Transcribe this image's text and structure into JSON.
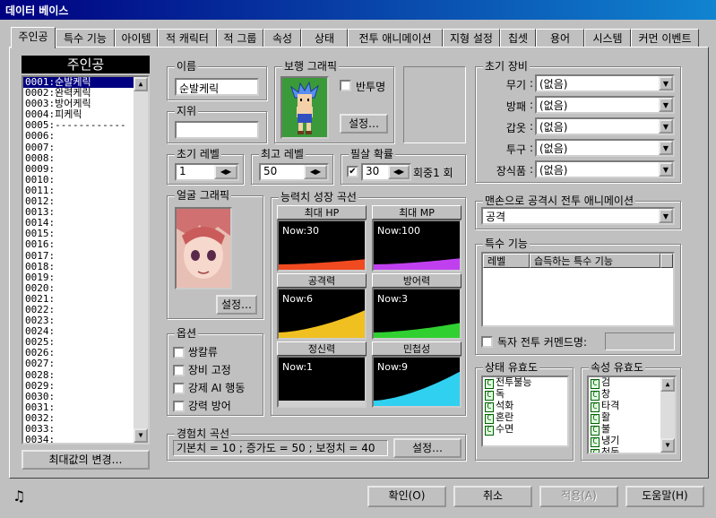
{
  "window": {
    "title": "데이터 베이스"
  },
  "tabs": [
    "주인공",
    "특수 기능",
    "아이템",
    "적 캐릭터",
    "적 그룹",
    "속성",
    "상태",
    "전투 애니메이션",
    "지형 설정",
    "칩셋",
    "용어",
    "시스템",
    "커먼 이벤트"
  ],
  "hero_list": {
    "title": "주인공",
    "items": [
      "0001:순발케릭",
      "0002:완력케릭",
      "0003:방어케릭",
      "0004:피케릭",
      "0005:------------",
      "0006:",
      "0007:",
      "0008:",
      "0009:",
      "0010:",
      "0011:",
      "0012:",
      "0013:",
      "0014:",
      "0015:",
      "0016:",
      "0017:",
      "0018:",
      "0019:",
      "0020:",
      "0021:",
      "0022:",
      "0023:",
      "0024:",
      "0025:",
      "0026:",
      "0027:",
      "0028:",
      "0029:",
      "0030:",
      "0031:",
      "0032:",
      "0033:",
      "0034:"
    ],
    "max_button": "최대값의 변경…"
  },
  "name": {
    "label": "이름",
    "value": "순발케릭"
  },
  "title_field": {
    "label": "지위",
    "value": ""
  },
  "walk_graphic": {
    "label": "보행 그래픽",
    "transparent_label": "반투명",
    "set_button": "설정…"
  },
  "init_level": {
    "label": "초기 레벨",
    "value": "1"
  },
  "max_level": {
    "label": "최고 레벨",
    "value": "50"
  },
  "critical": {
    "label": "필살 확률",
    "value": "30",
    "suffix": "회중1 회"
  },
  "face_graphic": {
    "label": "얼굴 그래픽",
    "set_button": "설정…"
  },
  "options": {
    "label": "옵션",
    "items": [
      "쌍칼류",
      "장비 고정",
      "강제 AI 행동",
      "강력 방어"
    ]
  },
  "stat_curves": {
    "label": "능력치 성장 곡선",
    "items": [
      {
        "name": "최대 HP",
        "now": "Now:30",
        "color": "#f04a20",
        "level": 0.15
      },
      {
        "name": "최대 MP",
        "now": "Now:100",
        "color": "#c040f0",
        "level": 0.18
      },
      {
        "name": "공격력",
        "now": "Now:6",
        "color": "#f0c020",
        "level": 0.65
      },
      {
        "name": "방어력",
        "now": "Now:3",
        "color": "#30d030",
        "level": 0.28
      },
      {
        "name": "정신력",
        "now": "Now:1",
        "color": "#d0d0d0",
        "level": 0.0
      },
      {
        "name": "민첩성",
        "now": "Now:9",
        "color": "#30d0f0",
        "level": 0.85
      }
    ]
  },
  "exp_curve": {
    "label": "경험치 곡선",
    "value": "기본치 = 10 ; 증가도 = 50 ; 보정치 = 40",
    "set_button": "설정…"
  },
  "equipment": {
    "label": "초기 장비",
    "slots": [
      {
        "name": "무기",
        "value": "(없음)"
      },
      {
        "name": "방패",
        "value": "(없음)"
      },
      {
        "name": "갑옷",
        "value": "(없음)"
      },
      {
        "name": "투구",
        "value": "(없음)"
      },
      {
        "name": "장식품",
        "value": "(없음)"
      }
    ]
  },
  "unarmed_anim": {
    "label": "맨손으로 공격시 전투 애니메이션",
    "value": "공격"
  },
  "skills": {
    "label": "특수 기능",
    "col_level": "레벨",
    "col_skill": "습득하는 특수 기능",
    "custom_cmd_label": "독자 전투 커멘드명:"
  },
  "state_eff": {
    "label": "상태 유효도",
    "items": [
      "전투불능",
      "독",
      "석화",
      "혼란",
      "수면"
    ]
  },
  "attr_eff": {
    "label": "속성 유효도",
    "items": [
      "검",
      "창",
      "타격",
      "활",
      "불",
      "냉기",
      "천둥"
    ]
  },
  "footer": {
    "ok": "확인(O)",
    "cancel": "취소",
    "apply": "적용(A)",
    "help": "도움말(H)"
  }
}
